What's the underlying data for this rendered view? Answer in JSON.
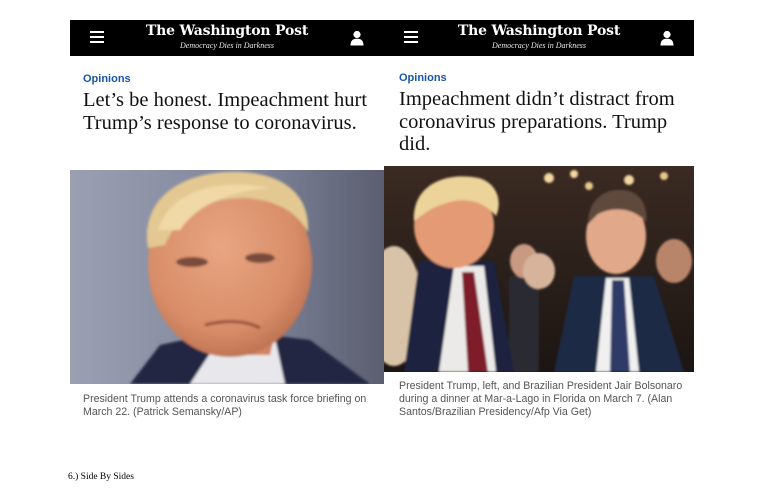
{
  "left_article": {
    "masthead": "The Washington Post",
    "tagline": "Democracy Dies in Darkness",
    "section": "Opinions",
    "headline": "Let’s be honest. Impeachment hurt Trump’s response to coronavirus.",
    "caption": "President Trump attends a coronavirus task force briefing on March 22. (Patrick Semansky/AP)",
    "icons": {
      "menu": "hamburger-menu-icon",
      "account": "user-account-icon"
    }
  },
  "right_article": {
    "masthead": "The Washington Post",
    "tagline": "Democracy Dies in Darkness",
    "section": "Opinions",
    "headline": "Impeachment didn’t distract from coronavirus preparations. Trump did.",
    "caption": "President Trump, left, and Brazilian President Jair Bolsonaro during a dinner at Mar-a-Lago in Florida on March 7. (Alan Santos/Brazilian Presidency/Afp Via Get)",
    "icons": {
      "menu": "hamburger-menu-icon",
      "account": "user-account-icon"
    }
  },
  "footnote": "6.) Side By Sides",
  "colors": {
    "header_bg": "#000000",
    "section_link": "#1955a5",
    "headline_text": "#111111",
    "caption_text": "#555555"
  }
}
